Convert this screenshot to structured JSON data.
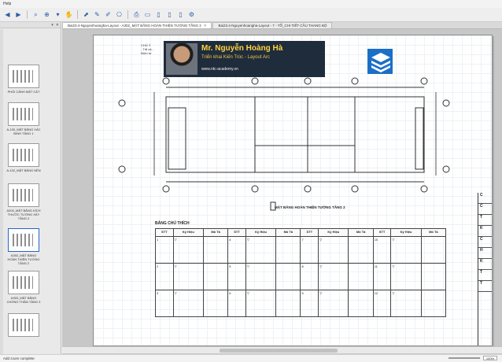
{
  "app": {
    "menu_label": "Help"
  },
  "toolbar": {
    "icons": [
      "back-icon",
      "forward-icon",
      "search-icon",
      "zoom-icon",
      "dropdown-icon",
      "hand-icon",
      "select-icon",
      "pen-icon",
      "marker-icon",
      "stamp-icon",
      "print-icon",
      "new-sheet-icon",
      "sheet-icon",
      "sheet-icon",
      "sheet-icon",
      "settings-icon"
    ]
  },
  "left_pane": {
    "header_icons": [
      "pin-icon",
      "close-icon"
    ],
    "thumbnails": [
      {
        "caption": "PHỐI CẢNH MẶT CẮT"
      },
      {
        "caption": "A-100_MẶT BẰNG XÁC ĐỊNH TẦNG 1"
      },
      {
        "caption": "A-102_MẶT BẰNG NỀN"
      },
      {
        "caption": "A200_MẶT BẰNG KÍCH THƯỚC TƯỜNG XÂY TẦNG 2"
      },
      {
        "caption": "A302_MẶT BẰNG HOÀN THIỆN TƯỜNG TẦNG 2"
      },
      {
        "caption": "A303_MẶT BẰNG CHỐNG THẤM TẦNG 3"
      },
      {
        "caption": ""
      }
    ]
  },
  "tabs": [
    {
      "label": "Bai23.4-Nguyenhoangha-Layout - A302_MẶT BẰNG HOÀN THIỆN TƯỜNG TẦNG 2",
      "active": true
    },
    {
      "label": "Bai23.4-Nguyenhoangha-Layout - 7 - TỔ_CHI TIẾT CẦU THANG BỘ",
      "active": false
    }
  ],
  "sheet": {
    "view_title": "MẶT BẰNG HOÀN THIỆN TƯỜNG TẦNG 2",
    "legend_title": "BẢNG CHÚ THÍCH",
    "legend_headers": [
      "STT",
      "Ký Hiệu",
      "Mô Tả",
      "STT",
      "Ký Hiệu",
      "Mô Tả",
      "STT",
      "Ký Hiệu",
      "Mô Tả",
      "STT",
      "Ký Hiệu",
      "Mô Tả"
    ],
    "legend_rows": [
      [
        "1",
        "",
        "",
        "4",
        "",
        "",
        "7",
        "",
        "",
        "10",
        "",
        ""
      ],
      [
        "2",
        "",
        "",
        "5",
        "",
        "",
        "8",
        "",
        "",
        "11",
        "",
        ""
      ],
      [
        "3",
        "",
        "",
        "6",
        "",
        "",
        "9",
        "",
        "",
        "12",
        "",
        ""
      ]
    ]
  },
  "banner": {
    "name": "Mr. Nguyễn Hoàng Hà",
    "role": "Triển khai Kiến Trúc - Layout Arc",
    "site": "www.ntc-academy.vn"
  },
  "status": {
    "left": "Add zoom complete",
    "zoom": "100%"
  }
}
